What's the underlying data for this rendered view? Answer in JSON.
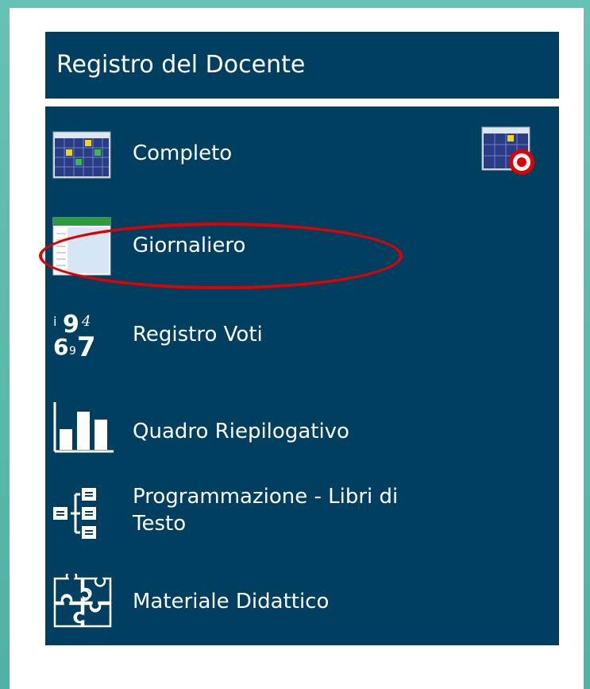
{
  "panel": {
    "title": "Registro del Docente"
  },
  "menu": {
    "items": [
      {
        "label": "Completo",
        "icon": "calendar-grid-icon"
      },
      {
        "label": "Giornaliero",
        "icon": "daily-register-icon"
      },
      {
        "label": "Registro Voti",
        "icon": "grades-icon"
      },
      {
        "label": "Quadro Riepilogativo",
        "icon": "bar-chart-icon"
      },
      {
        "label": "Programmazione - Libri di Testo",
        "label_line1": "Programmazione - Libri di",
        "label_line2": "Testo",
        "icon": "hierarchy-icon"
      },
      {
        "label": "Materiale Didattico",
        "icon": "puzzle-icon"
      }
    ],
    "shortcut_icon": "calendar-target-icon"
  },
  "annotation": {
    "highlight": "red-oval",
    "target": "Giornaliero"
  },
  "colors": {
    "panel_bg": "#003f5f",
    "page_bg": "#ffffff",
    "frame": "#5fbcae",
    "highlight": "#e00000"
  }
}
